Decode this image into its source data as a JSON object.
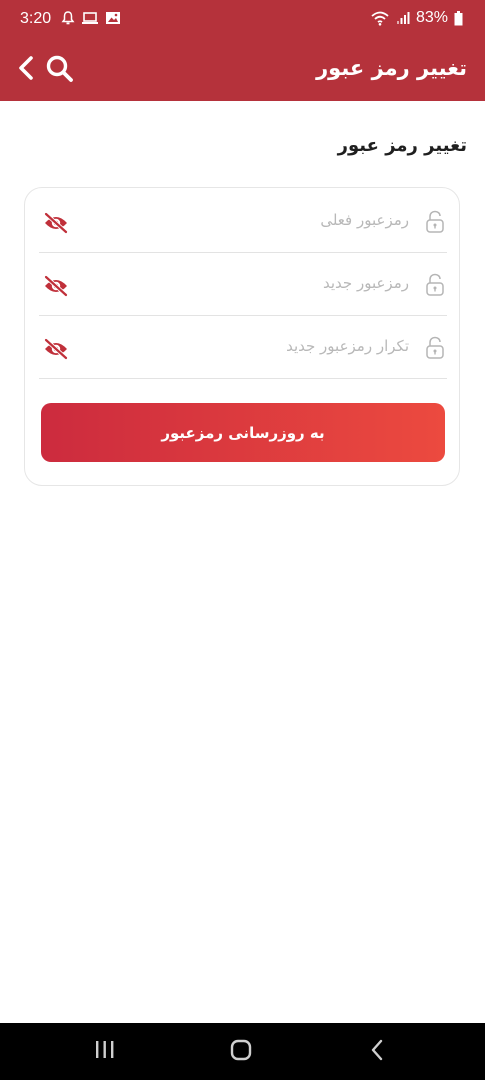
{
  "status_bar": {
    "time": "3:20",
    "battery": "83%"
  },
  "app_bar": {
    "title": "تغییر رمز عبور",
    "icons": [
      "back-chevron-icon",
      "search-icon"
    ]
  },
  "page": {
    "section_title": "تغییر رمز عبور",
    "fields": [
      {
        "placeholder": "رمزعبور فعلی",
        "icon": "lock-icon",
        "toggle": "eye-off-icon"
      },
      {
        "placeholder": "رمزعبور جدید",
        "icon": "lock-icon",
        "toggle": "eye-off-icon"
      },
      {
        "placeholder": "تکرار رمزعبور جدید",
        "icon": "lock-icon",
        "toggle": "eye-off-icon"
      }
    ],
    "submit_label": "به روزرسانی رمزعبور"
  },
  "colors": {
    "brand": "#b5323b",
    "button_start": "#cc2b3e",
    "button_end": "#ec4a3f",
    "eye_icon": "#c0303a"
  },
  "nav_bar": {
    "buttons": [
      "recent-apps-icon",
      "home-icon",
      "back-icon"
    ]
  }
}
